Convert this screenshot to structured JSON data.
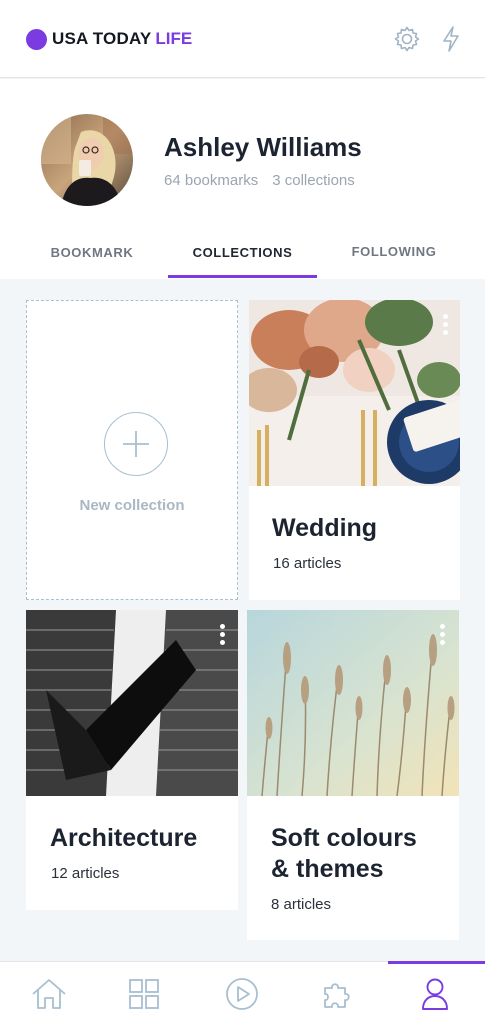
{
  "brand": {
    "name": "USA TODAY",
    "suffix": "LIFE",
    "accent": "#7a3be0"
  },
  "header": {
    "icons": [
      "gear-icon",
      "lightning-icon"
    ]
  },
  "profile": {
    "name": "Ashley Williams",
    "bookmarks": "64 bookmarks",
    "collections": "3 collections"
  },
  "tabs": [
    {
      "label": "BOOKMARK",
      "active": false
    },
    {
      "label": "COLLECTIONS",
      "active": true
    },
    {
      "label": "FOLLOWING",
      "active": false
    }
  ],
  "new_collection": {
    "label": "New collection",
    "icon": "plus-icon"
  },
  "collections": [
    {
      "title": "Wedding",
      "count": "16 articles"
    },
    {
      "title": "Architecture",
      "count": "12 articles"
    },
    {
      "title_line1": "Soft colours",
      "title_line2": "& themes",
      "count": "8 articles"
    }
  ],
  "bottom_nav": {
    "items": [
      "home-icon",
      "grid-icon",
      "play-icon",
      "puzzle-icon",
      "profile-icon"
    ],
    "active": "profile-icon"
  }
}
